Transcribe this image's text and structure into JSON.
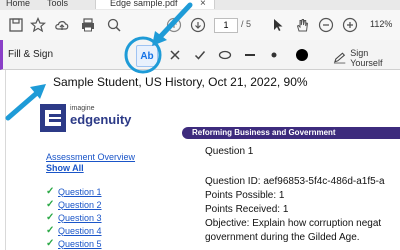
{
  "tabs": {
    "home": "Home",
    "tools": "Tools",
    "document": "Edge sample.pdf",
    "close": "×"
  },
  "toolbar": {
    "page_current": "1",
    "page_total": "/ 5",
    "zoom": "112%"
  },
  "fill_sign": {
    "title": "Fill & Sign",
    "text_tool": "Ab",
    "sign_label": "Sign Yourself"
  },
  "document": {
    "fill_text": "Sample Student, US History, Oct 21, 2022, 90%",
    "logo_small": "imagine",
    "logo_big": "edgenuity",
    "banner": "Reforming Business and Government",
    "nav_overview": "Assessment Overview",
    "nav_show_all": "Show All",
    "questions": [
      "Question 1",
      "Question 2",
      "Question 3",
      "Question 4",
      "Question 5"
    ],
    "content": {
      "question_title": "Question 1",
      "question_id": "Question ID: aef96853-5f4c-486d-a1f5-a",
      "points_possible": "Points Possible: 1",
      "points_received": "Points Received: 1",
      "objective": "Objective: Explain how corruption negat",
      "objective_cont": "government during the Gilded Age."
    }
  },
  "colors": {
    "accent_purple": "#8a3fc7",
    "annotation_blue": "#1e9bd7",
    "banner": "#3d2b7d",
    "link": "#1a55c8"
  }
}
